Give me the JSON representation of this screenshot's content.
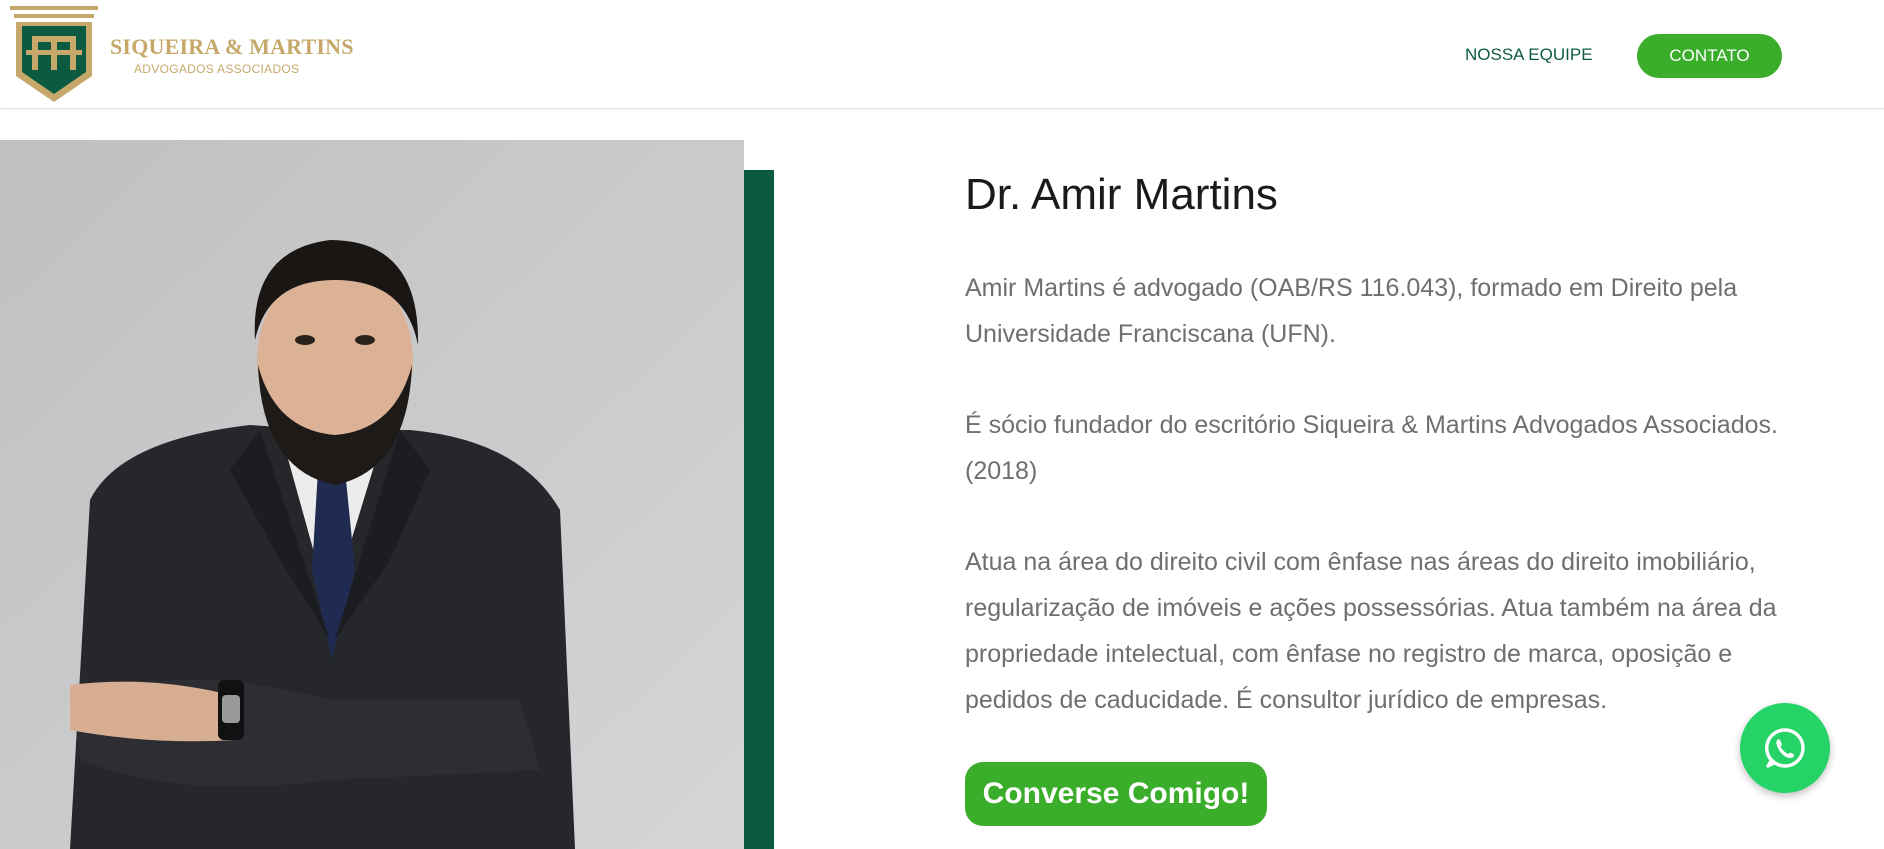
{
  "header": {
    "logo": {
      "name": "SIQUEIRA & MARTINS",
      "subtitle": "ADVOGADOS ASSOCIADOS"
    },
    "nav": {
      "team_label": "NOSSA EQUIPE",
      "contact_label": "CONTATO"
    }
  },
  "profile": {
    "name": "Dr. Amir Martins",
    "paragraphs": [
      "Amir Martins é advogado (OAB/RS 116.043), formado em Direito pela Universidade Franciscana (UFN).",
      "É sócio fundador do escritório Siqueira & Martins Advogados Associados. (2018)",
      "Atua na área do direito civil com ênfase nas áreas do direito imobiliário, regularização de imóveis e ações possessórias. Atua também na área da propriedade intelectual, com ênfase no registro de marca, oposição e pedidos de caducidade. É consultor jurídico de empresas."
    ],
    "cta_label": "Converse Comigo!"
  },
  "floating": {
    "icon": "whatsapp-icon"
  },
  "colors": {
    "brand_green": "#0c5a3f",
    "accent_green": "#3aae2a",
    "gold": "#c5a86a",
    "whatsapp": "#25d366",
    "text_gray": "#6f6f6f"
  }
}
